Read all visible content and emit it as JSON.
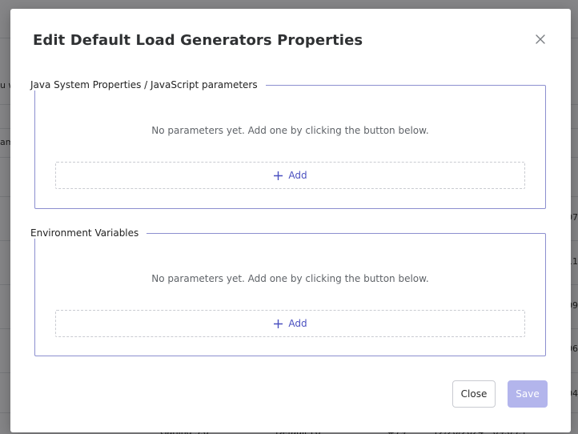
{
  "background": {
    "left_fragments": [
      "u w",
      "am"
    ],
    "right_fragments": [
      "07",
      "11",
      "09",
      "06",
      "04"
    ],
    "bottom_row": [
      "Gatling 3.6",
      "Default Lo",
      "#79",
      "12/20/2024",
      "09:03:1"
    ]
  },
  "modal": {
    "title": "Edit Default Load Generators Properties",
    "close_icon": "close-icon"
  },
  "java_group": {
    "legend": "Java System Properties / JavaScript parameters",
    "empty_message": "No parameters yet. Add one by clicking the button below.",
    "add_label": "Add"
  },
  "env_group": {
    "legend": "Environment Variables",
    "empty_message": "No parameters yet. Add one by clicking the button below.",
    "add_label": "Add"
  },
  "footer": {
    "close_label": "Close",
    "save_label": "Save"
  },
  "colors": {
    "accent": "#4a50c0",
    "border": "#8c8fcf",
    "save_disabled": "#b3b5ec"
  }
}
